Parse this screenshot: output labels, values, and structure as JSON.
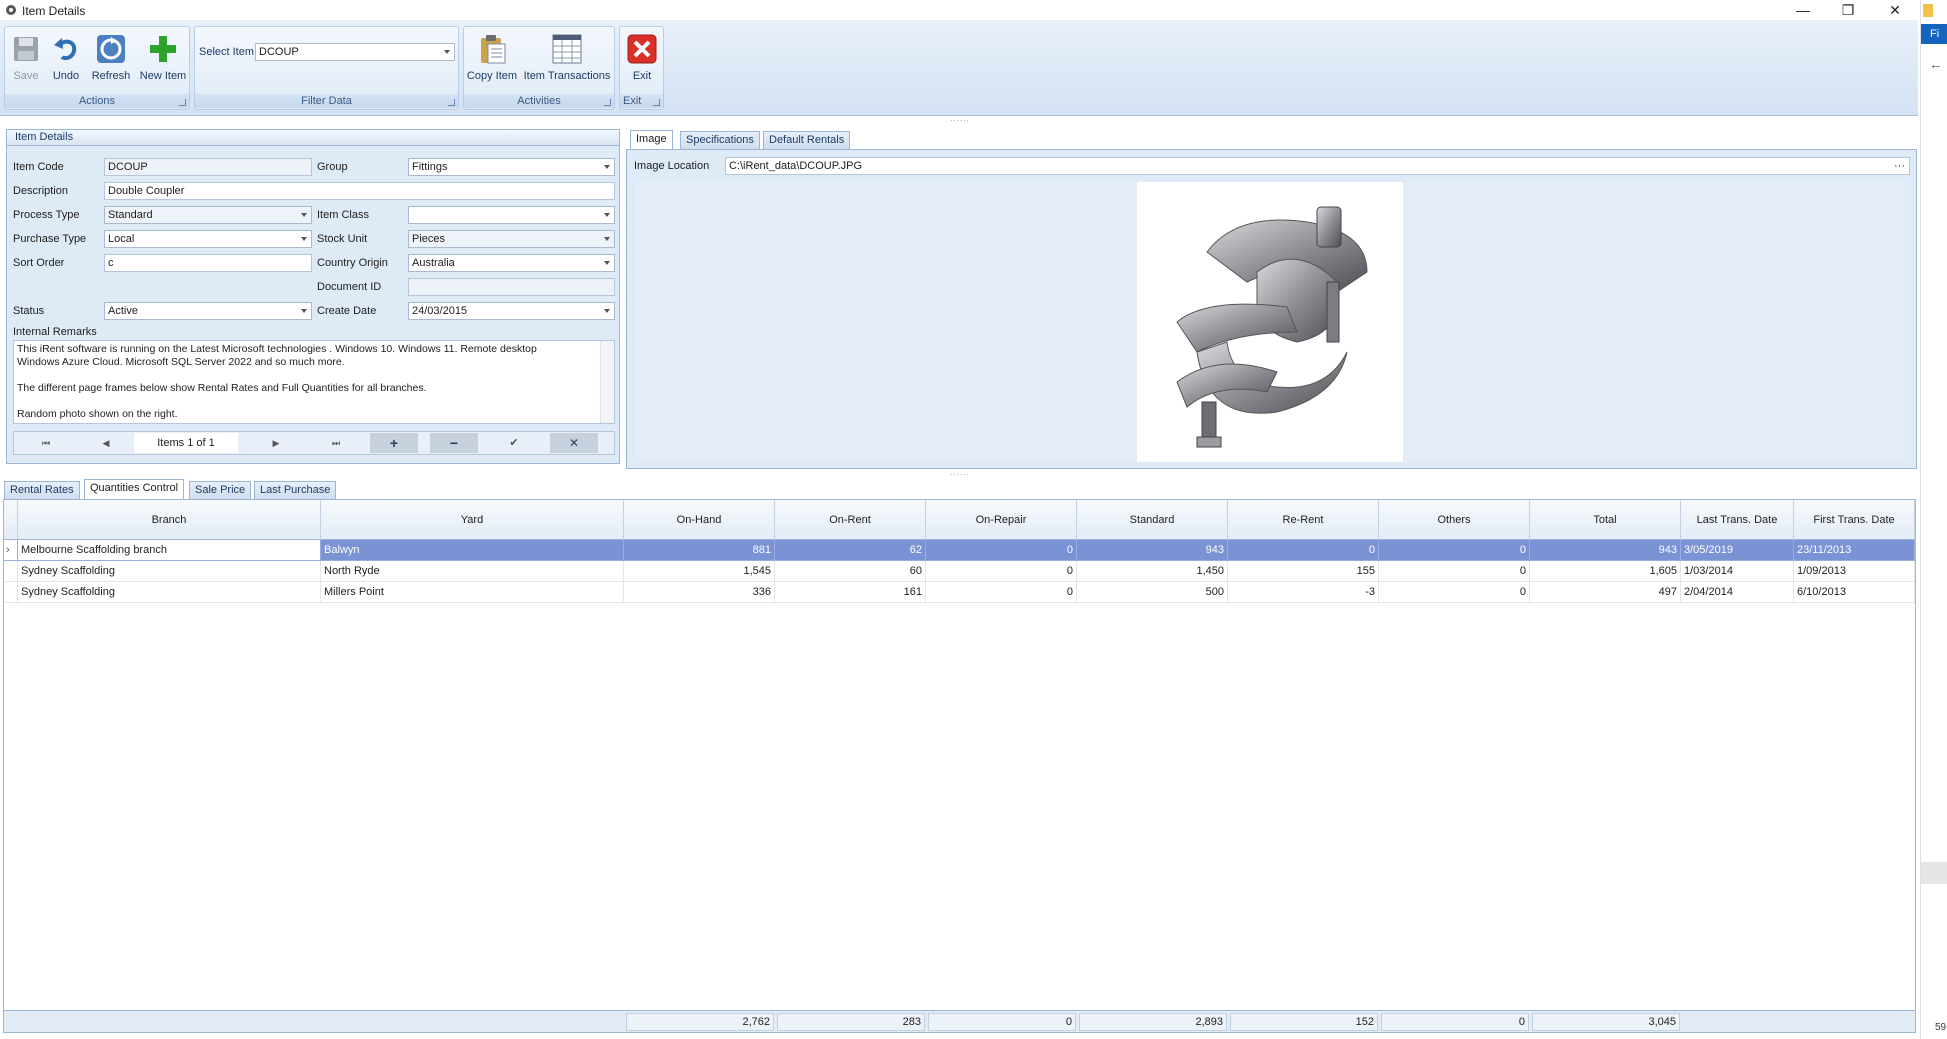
{
  "window": {
    "title": "Item Details",
    "minimize": "—",
    "restore": "❐",
    "close": "✕"
  },
  "ribbon": {
    "actions": {
      "label": "Actions",
      "save": "Save",
      "undo": "Undo",
      "refresh": "Refresh",
      "new_item": "New Item"
    },
    "filter": {
      "label": "Filter Data",
      "select_item_label": "Select Item",
      "select_item_value": "DCOUP"
    },
    "activities": {
      "label": "Activities",
      "copy_item": "Copy Item",
      "item_transactions": "Item Transactions"
    },
    "exit": {
      "label": "Exit",
      "exit": "Exit"
    }
  },
  "item_details": {
    "header": "Item Details",
    "item_code_label": "Item Code",
    "item_code": "DCOUP",
    "group_label": "Group",
    "group": "Fittings",
    "description_label": "Description",
    "description": "Double Coupler",
    "process_type_label": "Process Type",
    "process_type": "Standard",
    "item_class_label": "Item Class",
    "item_class": "",
    "purchase_type_label": "Purchase Type",
    "purchase_type": "Local",
    "stock_unit_label": "Stock Unit",
    "stock_unit": "Pieces",
    "sort_order_label": "Sort Order",
    "sort_order": "c",
    "country_origin_label": "Country Origin",
    "country_origin": "Australia",
    "document_id_label": "Document ID",
    "document_id": "",
    "status_label": "Status",
    "status": "Active",
    "create_date_label": "Create Date",
    "create_date": "24/03/2015",
    "remarks_label": "Internal Remarks",
    "remarks_line1": "This iRent software is running on the Latest Microsoft technologies . Windows 10. Windows 11. Remote desktop",
    "remarks_line2": "Windows Azure Cloud. Microsoft SQL Server 2022 and so much more.",
    "remarks_line3": "The different page frames below show Rental Rates and Full Quantities for all branches.",
    "remarks_line4": "Random photo shown on the right.",
    "nav_text": "Items  1 of 1",
    "nav_first": "⏮",
    "nav_prev": "◀",
    "nav_next": "▶",
    "nav_last": "⏭",
    "nav_add": "+",
    "nav_remove": "−",
    "nav_ok": "✔",
    "nav_cancel": "✕"
  },
  "right_tabs": {
    "tabs": [
      "Image",
      "Specifications",
      "Default Rentals"
    ],
    "image_location_label": "Image Location",
    "image_location": "C:\\iRent_data\\DCOUP.JPG",
    "browse": "···"
  },
  "bottom_tabs": [
    "Rental Rates",
    "Quantities Control",
    "Sale Price",
    "Last Purchase"
  ],
  "grid": {
    "columns": [
      "Branch",
      "Yard",
      "On-Hand",
      "On-Rent",
      "On-Repair",
      "Standard",
      "Re-Rent",
      "Others",
      "Total",
      "Last Trans. Date",
      "First Trans. Date"
    ],
    "rows": [
      [
        "Melbourne Scaffolding branch",
        "Balwyn",
        "881",
        "62",
        "0",
        "943",
        "0",
        "0",
        "943",
        "3/05/2019",
        "23/11/2013"
      ],
      [
        "Sydney Scaffolding",
        "North Ryde",
        "1,545",
        "60",
        "0",
        "1,450",
        "155",
        "0",
        "1,605",
        "1/03/2014",
        "1/09/2013"
      ],
      [
        "Sydney Scaffolding",
        "Millers Point",
        "336",
        "161",
        "0",
        "500",
        "-3",
        "0",
        "497",
        "2/04/2014",
        "6/10/2013"
      ]
    ],
    "totals": [
      "2,762",
      "283",
      "0",
      "2,893",
      "152",
      "0",
      "3,045"
    ]
  },
  "side_strip": {
    "top_text": "Fi",
    "back": "←",
    "bottom_text": "59"
  }
}
